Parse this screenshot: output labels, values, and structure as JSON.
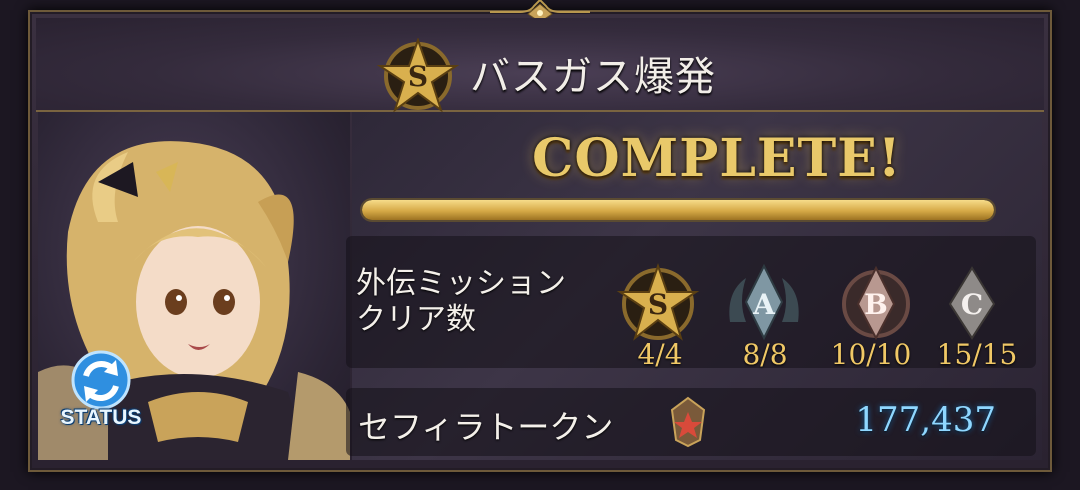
{
  "title": {
    "rank": "S",
    "text": "バスガス爆発"
  },
  "complete_label": "COMPLETE!",
  "progress": 1.0,
  "missions": {
    "label_line1": "外伝ミッション",
    "label_line2": "クリア数",
    "ranks": [
      {
        "letter": "S",
        "count": "4/4"
      },
      {
        "letter": "A",
        "count": "8/8"
      },
      {
        "letter": "B",
        "count": "10/10"
      },
      {
        "letter": "C",
        "count": "15/15"
      }
    ]
  },
  "tokens": {
    "label": "セフィラトークン",
    "value": "177,437",
    "icon": "sephira-token-icon"
  },
  "status_button": {
    "label": "STATUS",
    "icon": "refresh-icon"
  },
  "colors": {
    "gold": "#e9c96a",
    "count_gold": "#f0c866",
    "token_blue": "#8fd7ff",
    "status_blue": "#2f8fe0"
  }
}
